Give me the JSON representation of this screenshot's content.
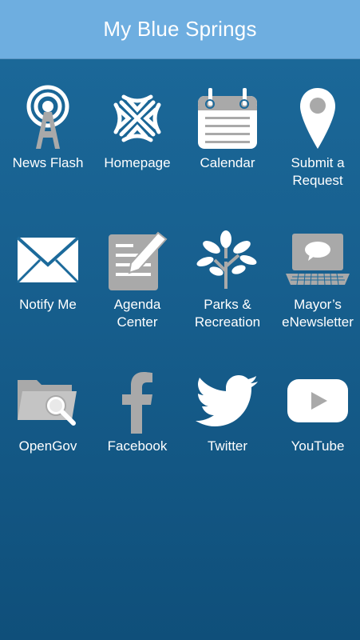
{
  "header": {
    "title": "My Blue Springs"
  },
  "colors": {
    "header_bg": "#6eaee0",
    "body_bg": "#175f8e",
    "icon_white": "#ffffff",
    "icon_gray": "#a9a9a9"
  },
  "tiles": [
    {
      "label": "News Flash",
      "icon": "radio-tower-icon"
    },
    {
      "label": "Homepage",
      "icon": "snowflake-logo-icon"
    },
    {
      "label": "Calendar",
      "icon": "calendar-icon"
    },
    {
      "label": "Submit a\nRequest",
      "icon": "map-pin-icon"
    },
    {
      "label": "Notify Me",
      "icon": "envelope-icon"
    },
    {
      "label": "Agenda\nCenter",
      "icon": "document-pencil-icon"
    },
    {
      "label": "Parks &\nRecreation",
      "icon": "tree-icon"
    },
    {
      "label": "Mayor’s\neNewsletter",
      "icon": "laptop-chat-icon"
    },
    {
      "label": "OpenGov",
      "icon": "folder-search-icon"
    },
    {
      "label": "Facebook",
      "icon": "facebook-icon"
    },
    {
      "label": "Twitter",
      "icon": "twitter-bird-icon"
    },
    {
      "label": "YouTube",
      "icon": "youtube-play-icon"
    }
  ]
}
